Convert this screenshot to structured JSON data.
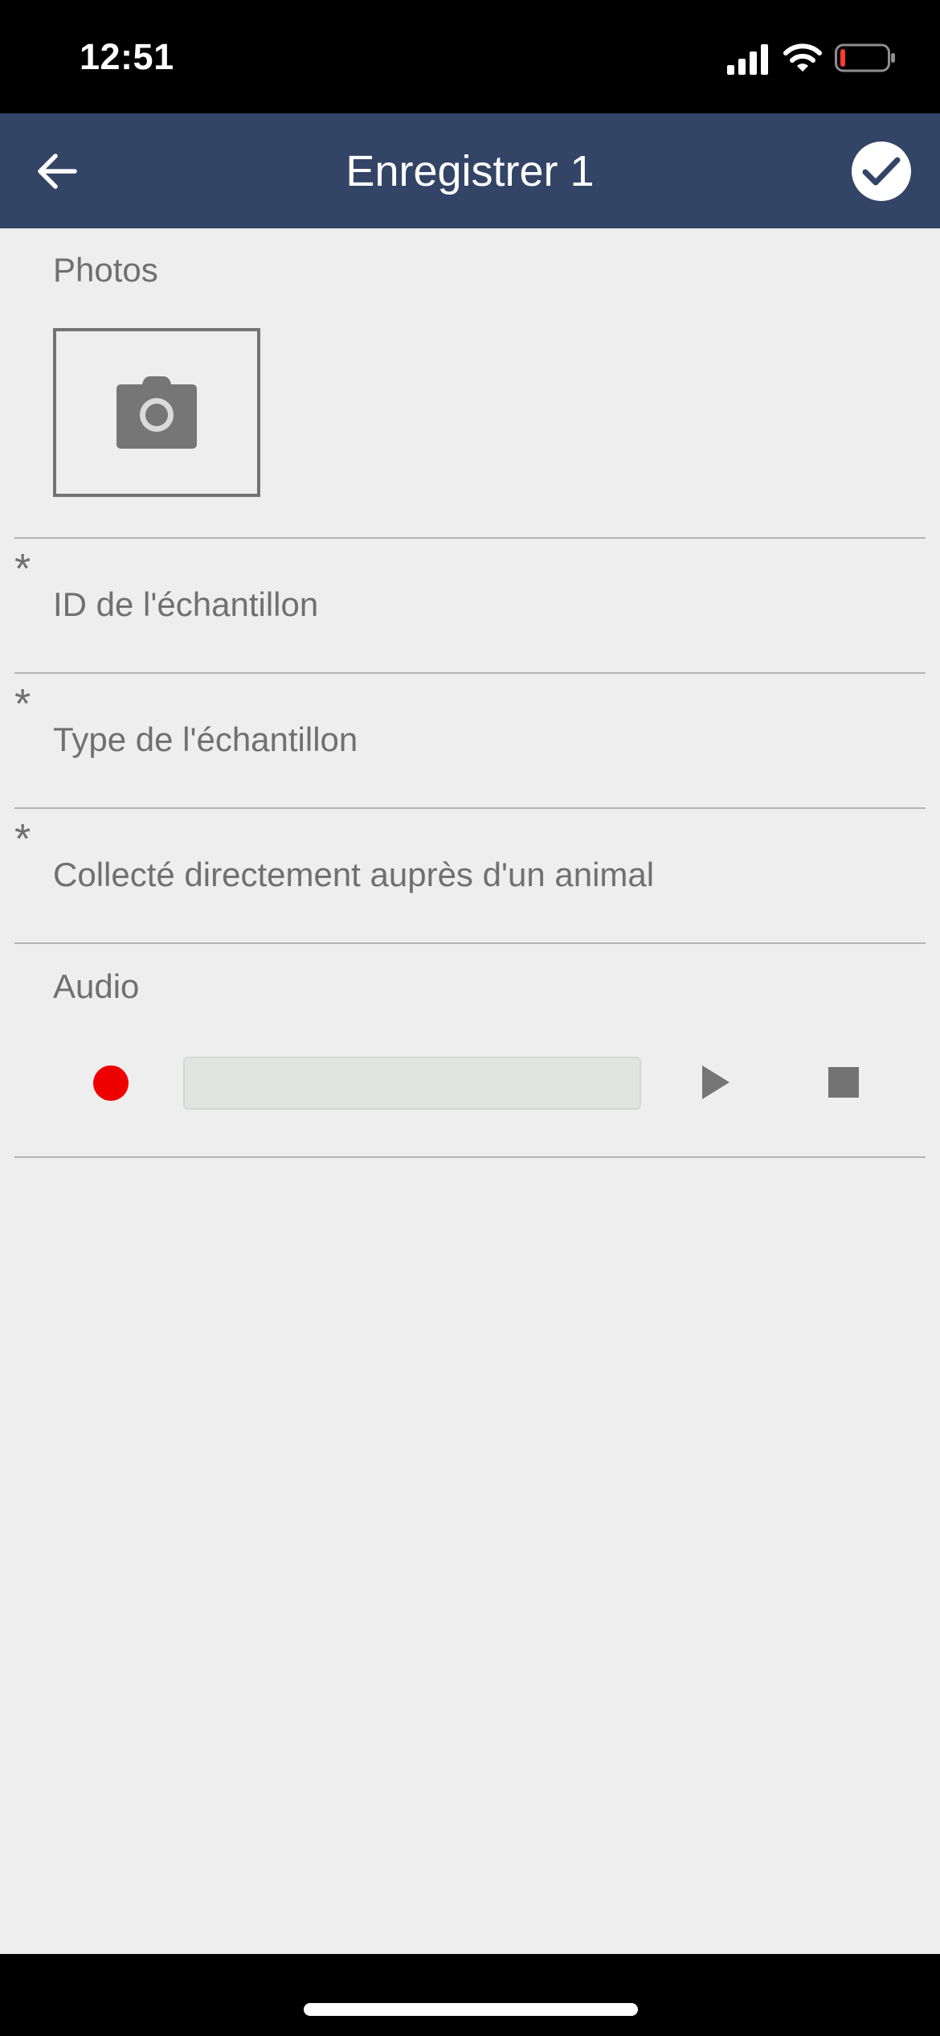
{
  "status_bar": {
    "time": "12:51",
    "icons": [
      "signal-icon",
      "wifi-icon",
      "battery-icon"
    ],
    "battery_color": "#ff3b30"
  },
  "header": {
    "title": "Enregistrer 1",
    "background": "#334566",
    "back_icon": "arrow-left-icon",
    "confirm_icon": "check-circle-icon"
  },
  "form": {
    "photos": {
      "label": "Photos",
      "icon": "camera-icon"
    },
    "fields": [
      {
        "required_mark": "*",
        "label": "ID de l'échantillon"
      },
      {
        "required_mark": "*",
        "label": "Type de l'échantillon"
      },
      {
        "required_mark": "*",
        "label": "Collecté directement auprès d'un animal"
      }
    ],
    "audio": {
      "label": "Audio",
      "record_icon": "record-icon",
      "play_icon": "play-icon",
      "stop_icon": "stop-icon",
      "record_color": "#ee0000",
      "progress": 0
    }
  }
}
